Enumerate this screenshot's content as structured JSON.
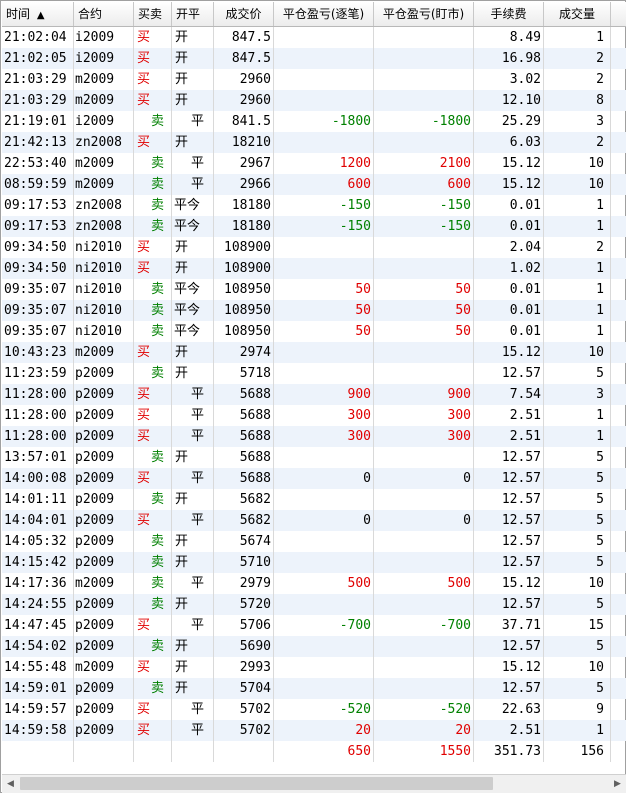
{
  "columns": [
    {
      "key": "time",
      "label": "时间",
      "sort": "▲"
    },
    {
      "key": "contract",
      "label": "合约"
    },
    {
      "key": "bs",
      "label": "买卖"
    },
    {
      "key": "oc",
      "label": "开平"
    },
    {
      "key": "price",
      "label": "成交价"
    },
    {
      "key": "pnl1",
      "label": "平仓盈亏(逐笔)"
    },
    {
      "key": "pnl2",
      "label": "平仓盈亏(盯市)"
    },
    {
      "key": "fee",
      "label": "手续费"
    },
    {
      "key": "vol",
      "label": "成交量"
    }
  ],
  "rows": [
    {
      "time": "21:02:04",
      "contract": "i2009",
      "bs": "买",
      "oc": "开",
      "price": "847.5",
      "pnl1": "",
      "pnl2": "",
      "fee": "8.49",
      "vol": "1"
    },
    {
      "time": "21:02:05",
      "contract": "i2009",
      "bs": "买",
      "oc": "开",
      "price": "847.5",
      "pnl1": "",
      "pnl2": "",
      "fee": "16.98",
      "vol": "2"
    },
    {
      "time": "21:03:29",
      "contract": "m2009",
      "bs": "买",
      "oc": "开",
      "price": "2960",
      "pnl1": "",
      "pnl2": "",
      "fee": "3.02",
      "vol": "2"
    },
    {
      "time": "21:03:29",
      "contract": "m2009",
      "bs": "买",
      "oc": "开",
      "price": "2960",
      "pnl1": "",
      "pnl2": "",
      "fee": "12.10",
      "vol": "8"
    },
    {
      "time": "21:19:01",
      "contract": "i2009",
      "bs": "卖",
      "oc": "平",
      "price": "841.5",
      "pnl1": "-1800",
      "pnl2": "-1800",
      "fee": "25.29",
      "vol": "3"
    },
    {
      "time": "21:42:13",
      "contract": "zn2008",
      "bs": "买",
      "oc": "开",
      "price": "18210",
      "pnl1": "",
      "pnl2": "",
      "fee": "6.03",
      "vol": "2"
    },
    {
      "time": "22:53:40",
      "contract": "m2009",
      "bs": "卖",
      "oc": "平",
      "price": "2967",
      "pnl1": "1200",
      "pnl2": "2100",
      "fee": "15.12",
      "vol": "10"
    },
    {
      "time": "08:59:59",
      "contract": "m2009",
      "bs": "卖",
      "oc": "平",
      "price": "2966",
      "pnl1": "600",
      "pnl2": "600",
      "fee": "15.12",
      "vol": "10"
    },
    {
      "time": "09:17:53",
      "contract": "zn2008",
      "bs": "卖",
      "oc": "平今",
      "price": "18180",
      "pnl1": "-150",
      "pnl2": "-150",
      "fee": "0.01",
      "vol": "1"
    },
    {
      "time": "09:17:53",
      "contract": "zn2008",
      "bs": "卖",
      "oc": "平今",
      "price": "18180",
      "pnl1": "-150",
      "pnl2": "-150",
      "fee": "0.01",
      "vol": "1"
    },
    {
      "time": "09:34:50",
      "contract": "ni2010",
      "bs": "买",
      "oc": "开",
      "price": "108900",
      "pnl1": "",
      "pnl2": "",
      "fee": "2.04",
      "vol": "2"
    },
    {
      "time": "09:34:50",
      "contract": "ni2010",
      "bs": "买",
      "oc": "开",
      "price": "108900",
      "pnl1": "",
      "pnl2": "",
      "fee": "1.02",
      "vol": "1"
    },
    {
      "time": "09:35:07",
      "contract": "ni2010",
      "bs": "卖",
      "oc": "平今",
      "price": "108950",
      "pnl1": "50",
      "pnl2": "50",
      "fee": "0.01",
      "vol": "1"
    },
    {
      "time": "09:35:07",
      "contract": "ni2010",
      "bs": "卖",
      "oc": "平今",
      "price": "108950",
      "pnl1": "50",
      "pnl2": "50",
      "fee": "0.01",
      "vol": "1"
    },
    {
      "time": "09:35:07",
      "contract": "ni2010",
      "bs": "卖",
      "oc": "平今",
      "price": "108950",
      "pnl1": "50",
      "pnl2": "50",
      "fee": "0.01",
      "vol": "1"
    },
    {
      "time": "10:43:23",
      "contract": "m2009",
      "bs": "买",
      "oc": "开",
      "price": "2974",
      "pnl1": "",
      "pnl2": "",
      "fee": "15.12",
      "vol": "10"
    },
    {
      "time": "11:23:59",
      "contract": "p2009",
      "bs": "卖",
      "oc": "开",
      "price": "5718",
      "pnl1": "",
      "pnl2": "",
      "fee": "12.57",
      "vol": "5"
    },
    {
      "time": "11:28:00",
      "contract": "p2009",
      "bs": "买",
      "oc": "平",
      "price": "5688",
      "pnl1": "900",
      "pnl2": "900",
      "fee": "7.54",
      "vol": "3"
    },
    {
      "time": "11:28:00",
      "contract": "p2009",
      "bs": "买",
      "oc": "平",
      "price": "5688",
      "pnl1": "300",
      "pnl2": "300",
      "fee": "2.51",
      "vol": "1"
    },
    {
      "time": "11:28:00",
      "contract": "p2009",
      "bs": "买",
      "oc": "平",
      "price": "5688",
      "pnl1": "300",
      "pnl2": "300",
      "fee": "2.51",
      "vol": "1"
    },
    {
      "time": "13:57:01",
      "contract": "p2009",
      "bs": "卖",
      "oc": "开",
      "price": "5688",
      "pnl1": "",
      "pnl2": "",
      "fee": "12.57",
      "vol": "5"
    },
    {
      "time": "14:00:08",
      "contract": "p2009",
      "bs": "买",
      "oc": "平",
      "price": "5688",
      "pnl1": "0",
      "pnl2": "0",
      "fee": "12.57",
      "vol": "5"
    },
    {
      "time": "14:01:11",
      "contract": "p2009",
      "bs": "卖",
      "oc": "开",
      "price": "5682",
      "pnl1": "",
      "pnl2": "",
      "fee": "12.57",
      "vol": "5"
    },
    {
      "time": "14:04:01",
      "contract": "p2009",
      "bs": "买",
      "oc": "平",
      "price": "5682",
      "pnl1": "0",
      "pnl2": "0",
      "fee": "12.57",
      "vol": "5"
    },
    {
      "time": "14:05:32",
      "contract": "p2009",
      "bs": "卖",
      "oc": "开",
      "price": "5674",
      "pnl1": "",
      "pnl2": "",
      "fee": "12.57",
      "vol": "5"
    },
    {
      "time": "14:15:42",
      "contract": "p2009",
      "bs": "卖",
      "oc": "开",
      "price": "5710",
      "pnl1": "",
      "pnl2": "",
      "fee": "12.57",
      "vol": "5"
    },
    {
      "time": "14:17:36",
      "contract": "m2009",
      "bs": "卖",
      "oc": "平",
      "price": "2979",
      "pnl1": "500",
      "pnl2": "500",
      "fee": "15.12",
      "vol": "10"
    },
    {
      "time": "14:24:55",
      "contract": "p2009",
      "bs": "卖",
      "oc": "开",
      "price": "5720",
      "pnl1": "",
      "pnl2": "",
      "fee": "12.57",
      "vol": "5"
    },
    {
      "time": "14:47:45",
      "contract": "p2009",
      "bs": "买",
      "oc": "平",
      "price": "5706",
      "pnl1": "-700",
      "pnl2": "-700",
      "fee": "37.71",
      "vol": "15"
    },
    {
      "time": "14:54:02",
      "contract": "p2009",
      "bs": "卖",
      "oc": "开",
      "price": "5690",
      "pnl1": "",
      "pnl2": "",
      "fee": "12.57",
      "vol": "5"
    },
    {
      "time": "14:55:48",
      "contract": "m2009",
      "bs": "买",
      "oc": "开",
      "price": "2993",
      "pnl1": "",
      "pnl2": "",
      "fee": "15.12",
      "vol": "10"
    },
    {
      "time": "14:59:01",
      "contract": "p2009",
      "bs": "卖",
      "oc": "开",
      "price": "5704",
      "pnl1": "",
      "pnl2": "",
      "fee": "12.57",
      "vol": "5"
    },
    {
      "time": "14:59:57",
      "contract": "p2009",
      "bs": "买",
      "oc": "平",
      "price": "5702",
      "pnl1": "-520",
      "pnl2": "-520",
      "fee": "22.63",
      "vol": "9"
    },
    {
      "time": "14:59:58",
      "contract": "p2009",
      "bs": "买",
      "oc": "平",
      "price": "5702",
      "pnl1": "20",
      "pnl2": "20",
      "fee": "2.51",
      "vol": "1"
    }
  ],
  "totals": {
    "pnl1": "650",
    "pnl2": "1550",
    "fee": "351.73",
    "vol": "156"
  },
  "scrollbar": {
    "left_arrow": "◀",
    "right_arrow": "▶"
  },
  "colors": {
    "buy": "#e00000",
    "sell": "#008000",
    "positive": "#e00000",
    "negative": "#008000",
    "row_alt": "#edf3fb"
  }
}
